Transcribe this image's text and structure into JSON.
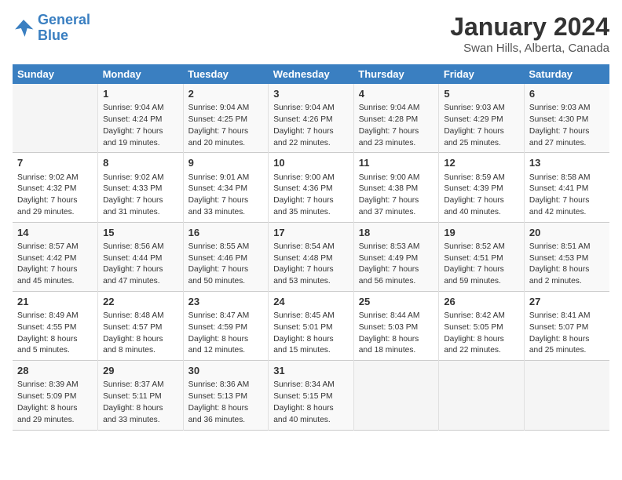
{
  "header": {
    "logo_line1": "General",
    "logo_line2": "Blue",
    "month": "January 2024",
    "location": "Swan Hills, Alberta, Canada"
  },
  "weekdays": [
    "Sunday",
    "Monday",
    "Tuesday",
    "Wednesday",
    "Thursday",
    "Friday",
    "Saturday"
  ],
  "weeks": [
    [
      {
        "day": "",
        "sunrise": "",
        "sunset": "",
        "daylight": ""
      },
      {
        "day": "1",
        "sunrise": "Sunrise: 9:04 AM",
        "sunset": "Sunset: 4:24 PM",
        "daylight": "Daylight: 7 hours and 19 minutes."
      },
      {
        "day": "2",
        "sunrise": "Sunrise: 9:04 AM",
        "sunset": "Sunset: 4:25 PM",
        "daylight": "Daylight: 7 hours and 20 minutes."
      },
      {
        "day": "3",
        "sunrise": "Sunrise: 9:04 AM",
        "sunset": "Sunset: 4:26 PM",
        "daylight": "Daylight: 7 hours and 22 minutes."
      },
      {
        "day": "4",
        "sunrise": "Sunrise: 9:04 AM",
        "sunset": "Sunset: 4:28 PM",
        "daylight": "Daylight: 7 hours and 23 minutes."
      },
      {
        "day": "5",
        "sunrise": "Sunrise: 9:03 AM",
        "sunset": "Sunset: 4:29 PM",
        "daylight": "Daylight: 7 hours and 25 minutes."
      },
      {
        "day": "6",
        "sunrise": "Sunrise: 9:03 AM",
        "sunset": "Sunset: 4:30 PM",
        "daylight": "Daylight: 7 hours and 27 minutes."
      }
    ],
    [
      {
        "day": "7",
        "sunrise": "Sunrise: 9:02 AM",
        "sunset": "Sunset: 4:32 PM",
        "daylight": "Daylight: 7 hours and 29 minutes."
      },
      {
        "day": "8",
        "sunrise": "Sunrise: 9:02 AM",
        "sunset": "Sunset: 4:33 PM",
        "daylight": "Daylight: 7 hours and 31 minutes."
      },
      {
        "day": "9",
        "sunrise": "Sunrise: 9:01 AM",
        "sunset": "Sunset: 4:34 PM",
        "daylight": "Daylight: 7 hours and 33 minutes."
      },
      {
        "day": "10",
        "sunrise": "Sunrise: 9:00 AM",
        "sunset": "Sunset: 4:36 PM",
        "daylight": "Daylight: 7 hours and 35 minutes."
      },
      {
        "day": "11",
        "sunrise": "Sunrise: 9:00 AM",
        "sunset": "Sunset: 4:38 PM",
        "daylight": "Daylight: 7 hours and 37 minutes."
      },
      {
        "day": "12",
        "sunrise": "Sunrise: 8:59 AM",
        "sunset": "Sunset: 4:39 PM",
        "daylight": "Daylight: 7 hours and 40 minutes."
      },
      {
        "day": "13",
        "sunrise": "Sunrise: 8:58 AM",
        "sunset": "Sunset: 4:41 PM",
        "daylight": "Daylight: 7 hours and 42 minutes."
      }
    ],
    [
      {
        "day": "14",
        "sunrise": "Sunrise: 8:57 AM",
        "sunset": "Sunset: 4:42 PM",
        "daylight": "Daylight: 7 hours and 45 minutes."
      },
      {
        "day": "15",
        "sunrise": "Sunrise: 8:56 AM",
        "sunset": "Sunset: 4:44 PM",
        "daylight": "Daylight: 7 hours and 47 minutes."
      },
      {
        "day": "16",
        "sunrise": "Sunrise: 8:55 AM",
        "sunset": "Sunset: 4:46 PM",
        "daylight": "Daylight: 7 hours and 50 minutes."
      },
      {
        "day": "17",
        "sunrise": "Sunrise: 8:54 AM",
        "sunset": "Sunset: 4:48 PM",
        "daylight": "Daylight: 7 hours and 53 minutes."
      },
      {
        "day": "18",
        "sunrise": "Sunrise: 8:53 AM",
        "sunset": "Sunset: 4:49 PM",
        "daylight": "Daylight: 7 hours and 56 minutes."
      },
      {
        "day": "19",
        "sunrise": "Sunrise: 8:52 AM",
        "sunset": "Sunset: 4:51 PM",
        "daylight": "Daylight: 7 hours and 59 minutes."
      },
      {
        "day": "20",
        "sunrise": "Sunrise: 8:51 AM",
        "sunset": "Sunset: 4:53 PM",
        "daylight": "Daylight: 8 hours and 2 minutes."
      }
    ],
    [
      {
        "day": "21",
        "sunrise": "Sunrise: 8:49 AM",
        "sunset": "Sunset: 4:55 PM",
        "daylight": "Daylight: 8 hours and 5 minutes."
      },
      {
        "day": "22",
        "sunrise": "Sunrise: 8:48 AM",
        "sunset": "Sunset: 4:57 PM",
        "daylight": "Daylight: 8 hours and 8 minutes."
      },
      {
        "day": "23",
        "sunrise": "Sunrise: 8:47 AM",
        "sunset": "Sunset: 4:59 PM",
        "daylight": "Daylight: 8 hours and 12 minutes."
      },
      {
        "day": "24",
        "sunrise": "Sunrise: 8:45 AM",
        "sunset": "Sunset: 5:01 PM",
        "daylight": "Daylight: 8 hours and 15 minutes."
      },
      {
        "day": "25",
        "sunrise": "Sunrise: 8:44 AM",
        "sunset": "Sunset: 5:03 PM",
        "daylight": "Daylight: 8 hours and 18 minutes."
      },
      {
        "day": "26",
        "sunrise": "Sunrise: 8:42 AM",
        "sunset": "Sunset: 5:05 PM",
        "daylight": "Daylight: 8 hours and 22 minutes."
      },
      {
        "day": "27",
        "sunrise": "Sunrise: 8:41 AM",
        "sunset": "Sunset: 5:07 PM",
        "daylight": "Daylight: 8 hours and 25 minutes."
      }
    ],
    [
      {
        "day": "28",
        "sunrise": "Sunrise: 8:39 AM",
        "sunset": "Sunset: 5:09 PM",
        "daylight": "Daylight: 8 hours and 29 minutes."
      },
      {
        "day": "29",
        "sunrise": "Sunrise: 8:37 AM",
        "sunset": "Sunset: 5:11 PM",
        "daylight": "Daylight: 8 hours and 33 minutes."
      },
      {
        "day": "30",
        "sunrise": "Sunrise: 8:36 AM",
        "sunset": "Sunset: 5:13 PM",
        "daylight": "Daylight: 8 hours and 36 minutes."
      },
      {
        "day": "31",
        "sunrise": "Sunrise: 8:34 AM",
        "sunset": "Sunset: 5:15 PM",
        "daylight": "Daylight: 8 hours and 40 minutes."
      },
      {
        "day": "",
        "sunrise": "",
        "sunset": "",
        "daylight": ""
      },
      {
        "day": "",
        "sunrise": "",
        "sunset": "",
        "daylight": ""
      },
      {
        "day": "",
        "sunrise": "",
        "sunset": "",
        "daylight": ""
      }
    ]
  ]
}
